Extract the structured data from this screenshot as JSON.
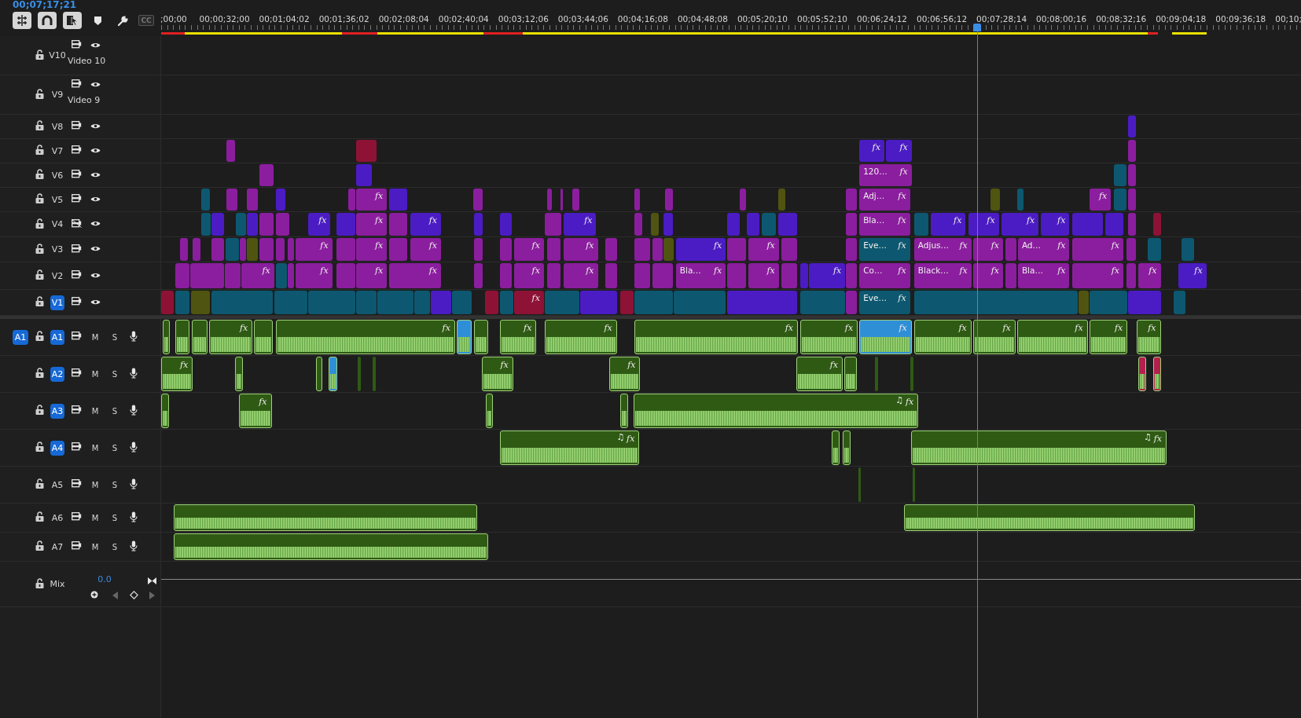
{
  "timecode": "00;07;17;21",
  "toolbar": [
    {
      "kind": "nest",
      "on": true
    },
    {
      "kind": "snap",
      "on": true
    },
    {
      "kind": "linked",
      "on": true
    },
    {
      "kind": "marker",
      "on": false
    },
    {
      "kind": "settings",
      "on": false
    },
    {
      "kind": "captions",
      "label": "CC",
      "on": false
    }
  ],
  "ruler": {
    "labels": [
      ";00;00",
      "00;00;32;00",
      "00;01;04;02",
      "00;01;36;02",
      "00;02;08;04",
      "00;02;40;04",
      "00;03;12;06",
      "00;03;44;06",
      "00;04;16;08",
      "00;04;48;08",
      "00;05;20;10",
      "00;05;52;10",
      "00;06;24;12",
      "00;06;56;12",
      "00;07;28;14",
      "00;08;00;16",
      "00;08;32;16",
      "00;09;04;18",
      "00;09;36;18",
      "00;10;"
    ],
    "playhead": {
      "level": 0.716
    }
  },
  "video_tracks": [
    {
      "name": "V10",
      "title": "Video 10",
      "targeted": false,
      "output_on": true
    },
    {
      "name": "V9",
      "title": "Video 9",
      "targeted": false,
      "output_on": true
    },
    {
      "name": "V8",
      "targeted": false,
      "output_on": true,
      "clips": [
        {
          "color": "#4b1cc4"
        }
      ]
    },
    {
      "name": "V7",
      "targeted": false,
      "output_on": true,
      "clips": [
        {
          "color": "#8b1e9e"
        },
        {
          "color": "#8e1236"
        },
        {
          "color": "#4b1cc4",
          "badge": "fx"
        },
        {
          "color": "#4b1cc4",
          "badge": "fx"
        },
        {
          "color": "#8b1e9e"
        }
      ]
    },
    {
      "name": "V6",
      "targeted": false,
      "output_on": true,
      "clips": [
        {
          "color": "#8b1e9e"
        },
        {
          "color": "#4b1cc4"
        },
        {
          "color": "#8b1e9e",
          "badge": "fx",
          "label": "120…"
        },
        {
          "color": "#0d5870"
        },
        {
          "color": "#8b1e9e"
        }
      ]
    },
    {
      "name": "V5",
      "targeted": false,
      "output_on": true,
      "clips": [
        {
          "color": "#0d5870"
        },
        {
          "color": "#8b1e9e"
        },
        {
          "color": "#8b1e9e"
        },
        {
          "color": "#4b1cc4"
        },
        {
          "color": "#8b1e9e"
        },
        {
          "color": "#8b1e9e",
          "badge": "fx"
        },
        {
          "color": "#4b1cc4"
        },
        {
          "color": "#8b1e9e"
        },
        {
          "color": "#8b1e9e"
        },
        {
          "color": "#8b1e9e"
        },
        {
          "color": "#8b1e9e"
        },
        {
          "color": "#8b1e9e"
        },
        {
          "color": "#8b1e9e"
        },
        {
          "color": "#8b1e9e"
        },
        {
          "color": "#4f5410"
        },
        {
          "color": "#8b1e9e"
        },
        {
          "color": "#8b1e9e",
          "badge": "fx",
          "label": "Adj…"
        },
        {
          "color": "#4f5410"
        },
        {
          "color": "#0d5870"
        },
        {
          "color": "#8b1e9e",
          "badge": "fx"
        },
        {
          "color": "#0d5870"
        },
        {
          "color": "#8b1e9e"
        }
      ]
    },
    {
      "name": "V4",
      "targeted": false,
      "output_on": false,
      "clips": [
        {
          "color": "#0d5870"
        },
        {
          "color": "#4b1cc4"
        },
        {
          "color": "#0d5870"
        },
        {
          "color": "#4b1cc4"
        },
        {
          "color": "#8b1e9e"
        },
        {
          "color": "#8b1e9e"
        },
        {
          "color": "#4b1cc4",
          "badge": "fx"
        },
        {
          "color": "#4b1cc4"
        },
        {
          "color": "#8b1e9e",
          "badge": "fx"
        },
        {
          "color": "#8b1e9e"
        },
        {
          "color": "#4b1cc4",
          "badge": "fx"
        },
        {
          "color": "#4b1cc4"
        },
        {
          "color": "#4b1cc4"
        },
        {
          "color": "#8b1e9e"
        },
        {
          "color": "#4b1cc4",
          "badge": "fx"
        },
        {
          "color": "#8b1e9e"
        },
        {
          "color": "#4f5410"
        },
        {
          "color": "#4b1cc4"
        },
        {
          "color": "#4b1cc4"
        },
        {
          "color": "#4b1cc4"
        },
        {
          "color": "#0d5870"
        },
        {
          "color": "#4b1cc4"
        },
        {
          "color": "#8b1e9e"
        },
        {
          "color": "#8b1e9e",
          "badge": "fx",
          "label": "Bla…"
        },
        {
          "color": "#0d5870"
        },
        {
          "color": "#4b1cc4",
          "badge": "fx"
        },
        {
          "color": "#4b1cc4",
          "badge": "fx"
        },
        {
          "color": "#4b1cc4",
          "badge": "fx"
        },
        {
          "color": "#4b1cc4",
          "badge": "fx"
        },
        {
          "color": "#4b1cc4"
        },
        {
          "color": "#4b1cc4"
        },
        {
          "color": "#8b1e9e"
        },
        {
          "color": "#8e1236"
        }
      ]
    },
    {
      "name": "V3",
      "targeted": false,
      "output_on": true,
      "clips": [
        {
          "color": "#8b1e9e"
        },
        {
          "color": "#8b1e9e"
        },
        {
          "color": "#8b1e9e"
        },
        {
          "color": "#0d5870"
        },
        {
          "color": "#8b1e9e"
        },
        {
          "color": "#4f5410"
        },
        {
          "color": "#8b1e9e"
        },
        {
          "color": "#8b1e9e"
        },
        {
          "color": "#8b1e9e"
        },
        {
          "color": "#8b1e9e",
          "badge": "fx"
        },
        {
          "color": "#8b1e9e"
        },
        {
          "color": "#8b1e9e",
          "badge": "fx"
        },
        {
          "color": "#8b1e9e"
        },
        {
          "color": "#8b1e9e",
          "badge": "fx"
        },
        {
          "color": "#8b1e9e"
        },
        {
          "color": "#8b1e9e"
        },
        {
          "color": "#8b1e9e",
          "badge": "fx"
        },
        {
          "color": "#8b1e9e"
        },
        {
          "color": "#8b1e9e",
          "badge": "fx"
        },
        {
          "color": "#8b1e9e"
        },
        {
          "color": "#8b1e9e"
        },
        {
          "color": "#8b1e9e"
        },
        {
          "color": "#4f5410"
        },
        {
          "color": "#4b1cc4",
          "badge": "fx"
        },
        {
          "color": "#8b1e9e"
        },
        {
          "color": "#8b1e9e",
          "badge": "fx"
        },
        {
          "color": "#8b1e9e"
        },
        {
          "color": "#8b1e9e"
        },
        {
          "color": "#0d5870",
          "badge": "fx",
          "label": "Eve…"
        },
        {
          "color": "#8b1e9e",
          "badge": "fx",
          "label": "Adjus…"
        },
        {
          "color": "#8b1e9e",
          "badge": "fx"
        },
        {
          "color": "#8b1e9e"
        },
        {
          "color": "#8b1e9e",
          "badge": "fx",
          "label": "Ad…"
        },
        {
          "color": "#8b1e9e",
          "badge": "fx"
        },
        {
          "color": "#8b1e9e"
        },
        {
          "color": "#0d5870"
        },
        {
          "color": "#0d5870"
        }
      ]
    },
    {
      "name": "V2",
      "targeted": false,
      "output_on": true,
      "clips": [
        {
          "color": "#8b1e9e"
        },
        {
          "color": "#8b1e9e"
        },
        {
          "color": "#8b1e9e"
        },
        {
          "color": "#8b1e9e",
          "badge": "fx"
        },
        {
          "color": "#0d5870"
        },
        {
          "color": "#8b1e9e"
        },
        {
          "color": "#8b1e9e",
          "badge": "fx"
        },
        {
          "color": "#8b1e9e"
        },
        {
          "color": "#8b1e9e",
          "badge": "fx"
        },
        {
          "color": "#8b1e9e",
          "badge": "fx"
        },
        {
          "color": "#8b1e9e"
        },
        {
          "color": "#8b1e9e"
        },
        {
          "color": "#8b1e9e",
          "badge": "fx"
        },
        {
          "color": "#8b1e9e"
        },
        {
          "color": "#8b1e9e",
          "badge": "fx"
        },
        {
          "color": "#8b1e9e"
        },
        {
          "color": "#8b1e9e"
        },
        {
          "color": "#8b1e9e"
        },
        {
          "color": "#8b1e9e",
          "badge": "fx",
          "label": "Bla…"
        },
        {
          "color": "#8b1e9e"
        },
        {
          "color": "#8b1e9e",
          "badge": "fx"
        },
        {
          "color": "#8b1e9e"
        },
        {
          "color": "#4b1cc4"
        },
        {
          "color": "#4b1cc4",
          "badge": "fx"
        },
        {
          "color": "#8b1e9e"
        },
        {
          "color": "#8b1e9e",
          "badge": "fx",
          "label": "Co…"
        },
        {
          "color": "#8b1e9e",
          "badge": "fx",
          "label": "Black…"
        },
        {
          "color": "#8b1e9e",
          "badge": "fx"
        },
        {
          "color": "#8b1e9e"
        },
        {
          "color": "#8b1e9e",
          "badge": "fx",
          "label": "Bla…"
        },
        {
          "color": "#8b1e9e",
          "badge": "fx"
        },
        {
          "color": "#8b1e9e"
        },
        {
          "color": "#8b1e9e",
          "badge": "fx"
        },
        {
          "color": "#4b1cc4",
          "badge": "fx"
        }
      ]
    },
    {
      "name": "V1",
      "targeted": true,
      "output_on": true,
      "clips": [
        {
          "color": "#8e1236"
        },
        {
          "color": "#0d5870"
        },
        {
          "color": "#4f5410"
        },
        {
          "color": "#0d5870"
        },
        {
          "color": "#0d5870"
        },
        {
          "color": "#0d5870"
        },
        {
          "color": "#0d5870"
        },
        {
          "color": "#0d5870"
        },
        {
          "color": "#0d5870"
        },
        {
          "color": "#4b1cc4"
        },
        {
          "color": "#0d5870"
        },
        {
          "color": "#8e1236"
        },
        {
          "color": "#0d5870"
        },
        {
          "color": "#8e1236",
          "badge": "fx"
        },
        {
          "color": "#0d5870"
        },
        {
          "color": "#4b1cc4"
        },
        {
          "color": "#8e1236"
        },
        {
          "color": "#0d5870"
        },
        {
          "color": "#0d5870"
        },
        {
          "color": "#4b1cc4"
        },
        {
          "color": "#0d5870"
        },
        {
          "color": "#8b1e9e"
        },
        {
          "color": "#0d5870",
          "badge": "fx",
          "label": "Eve…"
        },
        {
          "color": "#0d5870"
        },
        {
          "color": "#4f5410"
        },
        {
          "color": "#0d5870"
        },
        {
          "color": "#4b1cc4"
        },
        {
          "color": "#0d5870"
        }
      ]
    }
  ],
  "audio_tracks": [
    {
      "name": "A1",
      "source_patch": "A1",
      "targeted": true,
      "mute_label": "M",
      "solo_label": "S",
      "clips": [
        {
          "color": "#2f5a14"
        },
        {
          "color": "#2f5a14"
        },
        {
          "color": "#2f5a14"
        },
        {
          "color": "#2f5a14",
          "badge": "fx"
        },
        {
          "color": "#2f5a14"
        },
        {
          "color": "#2f5a14",
          "badge": "fx"
        },
        {
          "color": "#2f8fd6"
        },
        {
          "color": "#2f5a14"
        },
        {
          "color": "#2f5a14",
          "badge": "fx"
        },
        {
          "color": "#2f5a14",
          "badge": "fx"
        },
        {
          "color": "#2f5a14",
          "badge": "fx"
        },
        {
          "color": "#2f5a14",
          "badge": "fx"
        },
        {
          "color": "#2f8fd6",
          "badge": "fx"
        },
        {
          "color": "#2f5a14",
          "badge": "fx"
        },
        {
          "color": "#2f5a14",
          "badge": "fx"
        },
        {
          "color": "#2f5a14",
          "badge": "fx"
        },
        {
          "color": "#2f5a14",
          "badge": "fx"
        },
        {
          "color": "#2f5a14",
          "badge": "fx"
        }
      ]
    },
    {
      "name": "A2",
      "targeted": true,
      "mute_label": "M",
      "solo_label": "S",
      "clips": [
        {
          "color": "#2f5a14",
          "badge": "fx"
        },
        {
          "color": "#2f5a14"
        },
        {
          "color": "#2f5a14"
        },
        {
          "color": "#2f8fd6"
        },
        {
          "color": "#2f5a14"
        },
        {
          "color": "#2f5a14"
        },
        {
          "color": "#2f5a14",
          "badge": "fx"
        },
        {
          "color": "#2f5a14",
          "badge": "fx"
        },
        {
          "color": "#2f5a14",
          "badge": "fx"
        },
        {
          "color": "#2f5a14"
        },
        {
          "color": "#2f5a14"
        },
        {
          "color": "#2f5a14"
        },
        {
          "color": "#b3204e"
        },
        {
          "color": "#b3204e"
        }
      ]
    },
    {
      "name": "A3",
      "targeted": true,
      "mute_label": "M",
      "solo_label": "S",
      "clips": [
        {
          "color": "#2f5a14"
        },
        {
          "color": "#2f5a14",
          "badge": "fx"
        },
        {
          "color": "#2f5a14"
        },
        {
          "color": "#2f5a14"
        },
        {
          "color": "#2f5a14",
          "badge": "fx",
          "note": "♫"
        }
      ]
    },
    {
      "name": "A4",
      "targeted": true,
      "mute_label": "M",
      "solo_label": "S",
      "clips": [
        {
          "color": "#2f5a14",
          "badge": "fx",
          "note": "♫"
        },
        {
          "color": "#2f5a14"
        },
        {
          "color": "#2f5a14"
        },
        {
          "color": "#2f5a14",
          "badge": "fx",
          "note": "♫"
        }
      ]
    },
    {
      "name": "A5",
      "targeted": false,
      "mute_label": "M",
      "solo_label": "S",
      "clips": [
        {
          "color": "#2f5a14"
        },
        {
          "color": "#2f5a14"
        }
      ]
    },
    {
      "name": "A6",
      "targeted": false,
      "mute_label": "M",
      "solo_label": "S",
      "clips": [
        {
          "color": "#2f5a14"
        },
        {
          "color": "#2f5a14"
        }
      ]
    },
    {
      "name": "A7",
      "targeted": false,
      "mute_label": "M",
      "solo_label": "S",
      "clips": [
        {
          "color": "#2f5a14"
        }
      ]
    }
  ],
  "mix": {
    "name": "Mix",
    "volume": "0.0"
  }
}
